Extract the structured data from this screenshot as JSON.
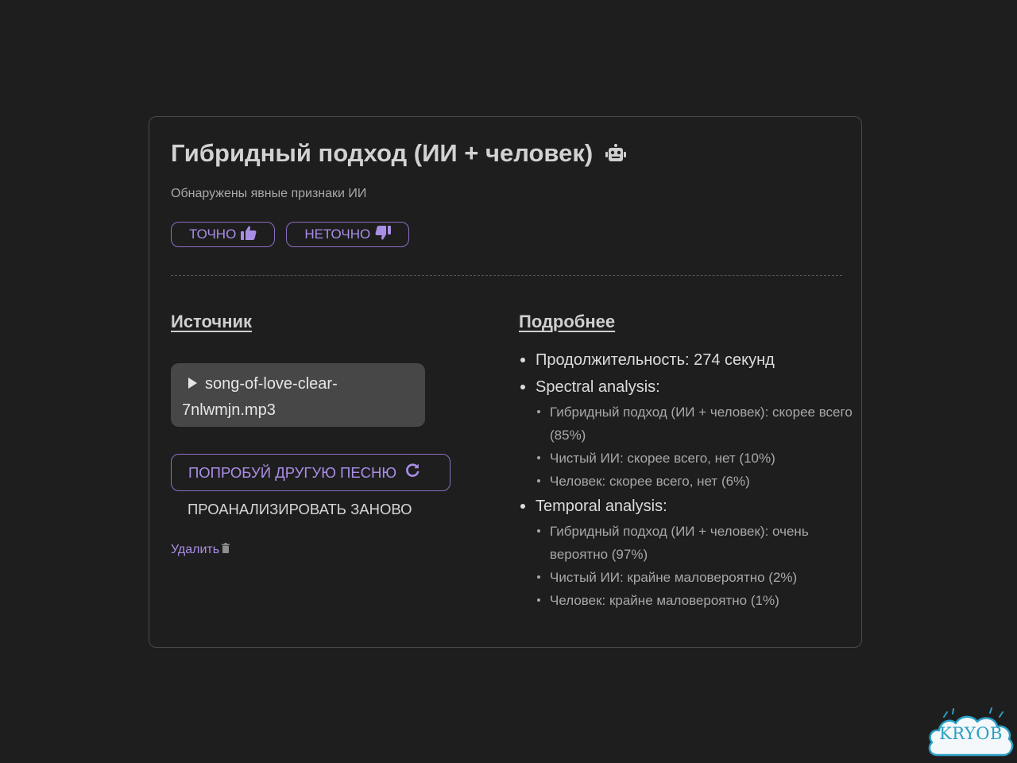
{
  "result": {
    "title": "Гибридный подход (ИИ + человек)",
    "title_icon": "robot-icon",
    "subtitle": "Обнаружены явные признаки ИИ"
  },
  "feedback": {
    "accurate_label": "ТОЧНО",
    "accurate_icon": "thumbs-up-icon",
    "inaccurate_label": "НЕТОЧНО",
    "inaccurate_icon": "thumbs-down-icon"
  },
  "source": {
    "heading": "Источник",
    "player_filename": "song-of-love-clear-7nlwmjn.mp3",
    "try_another_label": "ПОПРОБУЙ ДРУГУЮ ПЕСНЮ",
    "try_another_icon": "refresh-icon",
    "reanalyze_label": "ПРОАНАЛИЗИРОВАТЬ ЗАНОВО",
    "delete_label": "Удалить",
    "delete_icon": "trash-icon"
  },
  "details": {
    "heading": "Подробнее",
    "duration": "Продолжительность: 274 секунд",
    "spectral": {
      "label": "Spectral analysis:",
      "items": [
        "Гибридный подход (ИИ + человек): скорее всего (85%)",
        "Чистый ИИ: скорее всего, нет (10%)",
        "Человек: скорее всего, нет (6%)"
      ]
    },
    "temporal": {
      "label": "Temporal analysis:",
      "items": [
        "Гибридный подход (ИИ + человек): очень вероятно (97%)",
        "Чистый ИИ: крайне маловероятно (2%)",
        "Человек: крайне маловероятно (1%)"
      ]
    }
  },
  "watermark": {
    "text": "KRYOB"
  },
  "colors": {
    "background": "#1f1e1f",
    "accent": "#a98ee6",
    "accent_border": "#8a6fc2",
    "player_bg": "#474747",
    "logo": "#2a9fc4"
  }
}
